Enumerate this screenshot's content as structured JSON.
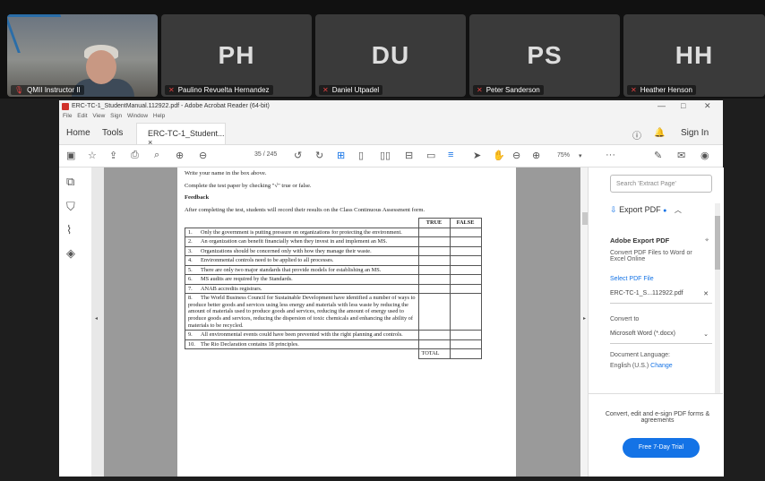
{
  "participants": [
    {
      "name": "QMII Instructor II",
      "initials": "",
      "video": true
    },
    {
      "name": "Paulino Revuelta Hernandez",
      "initials": "PH"
    },
    {
      "name": "Daniel Utpadel",
      "initials": "DU"
    },
    {
      "name": "Peter Sanderson",
      "initials": "PS"
    },
    {
      "name": "Heather Henson",
      "initials": "HH"
    }
  ],
  "window": {
    "title": "ERC-TC-1_StudentManual.112922.pdf - Adobe Acrobat Reader (64-bit)",
    "menu": [
      "File",
      "Edit",
      "View",
      "Sign",
      "Window",
      "Help"
    ],
    "minimize": "—",
    "maximize": "□",
    "close": "✕"
  },
  "tabs": {
    "home": "Home",
    "tools": "Tools",
    "doc": "ERC-TC-1_Student...",
    "sign_in": "Sign In"
  },
  "toolbar": {
    "page_current": "35",
    "page_total": "/ 245",
    "zoom": "75%",
    "more": "···"
  },
  "document": {
    "line1": "Write your name in the box above.",
    "line2": "Complete the test paper by checking \"√\" true or false.",
    "heading": "Feedback",
    "line3": "After completing the test, students will record their results on the Class Continuous Assessment form.",
    "table": {
      "col_true": "TRUE",
      "col_false": "FALSE",
      "total": "TOTAL",
      "rows": [
        {
          "n": "1.",
          "text": "Only the government is putting pressure on organizations for protecting the environment."
        },
        {
          "n": "2.",
          "text": "An organization can benefit financially when they invest in and implement an MS."
        },
        {
          "n": "3.",
          "text": "Organizations should be concerned only with how they manage their waste."
        },
        {
          "n": "4.",
          "text": "Environmental controls need to be applied to all processes."
        },
        {
          "n": "5.",
          "text": "There are only two major standards that provide models for establishing an MS."
        },
        {
          "n": "6.",
          "text": "MS audits are required by the Standards."
        },
        {
          "n": "7.",
          "text": "ANAB accredits registrars."
        },
        {
          "n": "8.",
          "text": "The World Business Council for Sustainable Development have identified a number of ways to produce better goods and services using less energy and materials with less waste by reducing the amount of materials used to produce goods and services, reducing the amount of energy used to produce goods and services, reducing the dispersion of toxic chemicals and enhancing the ability of materials to be recycled."
        },
        {
          "n": "9.",
          "text": "All environmental events could have been prevented with the right planning and controls."
        },
        {
          "n": "10.",
          "text": "The Rio Declaration contains 18 principles."
        }
      ]
    }
  },
  "panel": {
    "search_placeholder": "Search 'Extract Page'",
    "export_label": "Export PDF",
    "title": "Adobe Export PDF",
    "desc": "Convert PDF Files to Word or Excel Online",
    "select_pdf": "Select PDF File",
    "file": "ERC-TC-1_S...112922.pdf",
    "convert_to": "Convert to",
    "format": "Microsoft Word (*.docx)",
    "lang_label": "Document Language:",
    "lang": "English (U.S.)",
    "change": "Change",
    "promo": "Convert, edit and e-sign PDF forms & agreements",
    "trial": "Free 7-Day Trial"
  }
}
